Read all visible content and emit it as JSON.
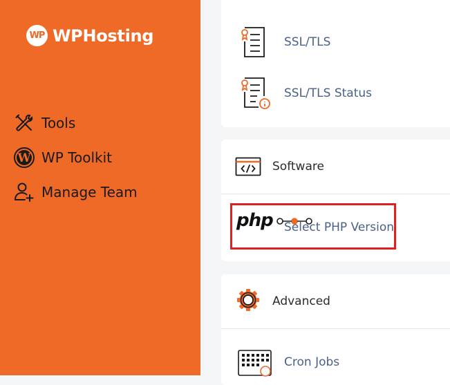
{
  "brand": {
    "name": "WPHosting",
    "mark": "WP"
  },
  "sidebar": {
    "items": [
      {
        "label": "Tools",
        "icon": "tools-icon"
      },
      {
        "label": "WP Toolkit",
        "icon": "wordpress-icon"
      },
      {
        "label": "Manage Team",
        "icon": "add-user-icon"
      }
    ]
  },
  "security": {
    "items": [
      {
        "label": "SSL/TLS",
        "icon": "certificate-icon"
      },
      {
        "label": "SSL/TLS Status",
        "icon": "certificate-status-icon"
      }
    ]
  },
  "software": {
    "title": "Software",
    "icon": "code-window-icon",
    "items": [
      {
        "label": "Select PHP Version",
        "icon": "php-icon",
        "icon_text": "php"
      }
    ]
  },
  "advanced": {
    "title": "Advanced",
    "icon": "gear-icon",
    "items": [
      {
        "label": "Cron Jobs",
        "icon": "calendar-clock-icon"
      }
    ]
  },
  "colors": {
    "sidebar": "#ee6a26",
    "link": "#4a6089",
    "highlight": "#e02020",
    "accent": "#ee6a26"
  }
}
